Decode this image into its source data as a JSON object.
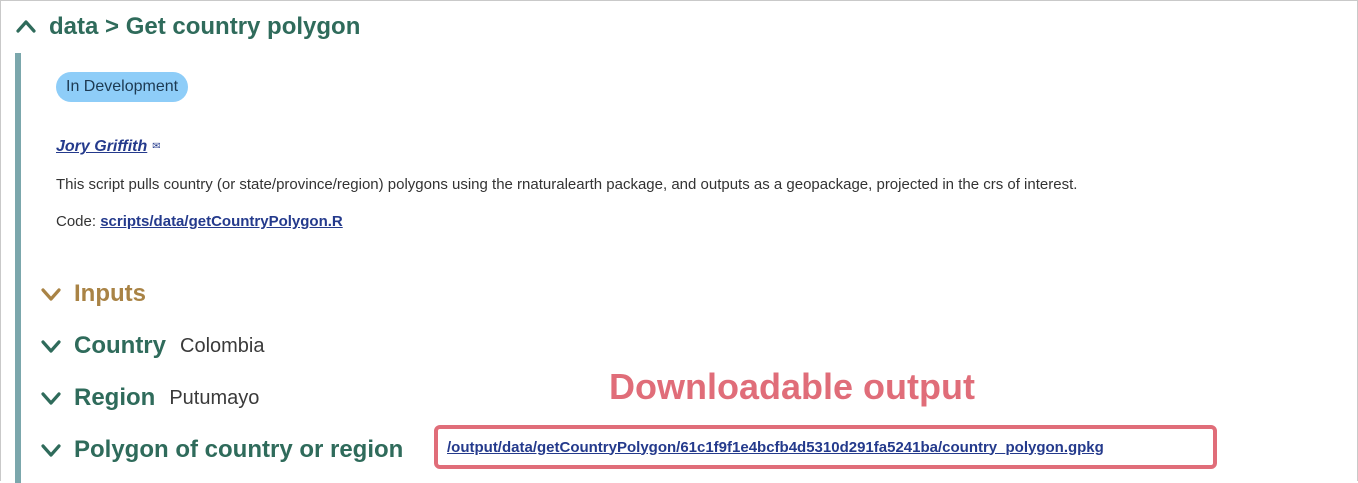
{
  "header": {
    "title": "data > Get country polygon"
  },
  "script": {
    "status_badge": "In Development",
    "author": "Jory Griffith",
    "author_contact_icon": "email-icon",
    "description": "This script pulls country (or state/province/region) polygons using the rnaturalearth package, and outputs as a geopackage, projected in the crs of interest.",
    "code_label": "Code: ",
    "code_link": "scripts/data/getCountryPolygon.R"
  },
  "sections": {
    "inputs": {
      "title": "Inputs"
    },
    "country": {
      "title": "Country",
      "value": "Colombia"
    },
    "region": {
      "title": "Region",
      "value": "Putumayo"
    },
    "polygon": {
      "title": "Polygon of country or region",
      "value": "/output/data/getCountryPolygon/61c1f9f1e4bcfb4d5310d291fa5241ba/country_polygon.gpkg"
    }
  },
  "annotation": {
    "label": "Downloadable output"
  },
  "colors": {
    "header_green": "#2f6b5b",
    "inputs_gold": "#a98345",
    "badge_blue": "#8ecdf8",
    "link_blue": "#243a8c",
    "annotation_red": "#e06d79",
    "rail": "#7ba7ac"
  }
}
